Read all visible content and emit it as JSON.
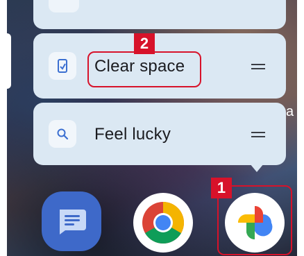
{
  "menu": {
    "items": [
      {
        "label": "Clear space",
        "icon": "app-shortcut-icon"
      },
      {
        "label": "Feel lucky",
        "icon": "search-icon"
      }
    ]
  },
  "annotations": {
    "badge_1": "1",
    "badge_2": "2"
  },
  "background_text": "a",
  "dock": {
    "apps": [
      {
        "icon": "messages-app-icon"
      },
      {
        "icon": "chrome-app-icon"
      },
      {
        "icon": "google-photos-app-icon"
      }
    ]
  },
  "colors": {
    "menu_background": "#dbe8f3",
    "highlight": "#d7122a",
    "icon_accent": "#3b6fd1"
  }
}
